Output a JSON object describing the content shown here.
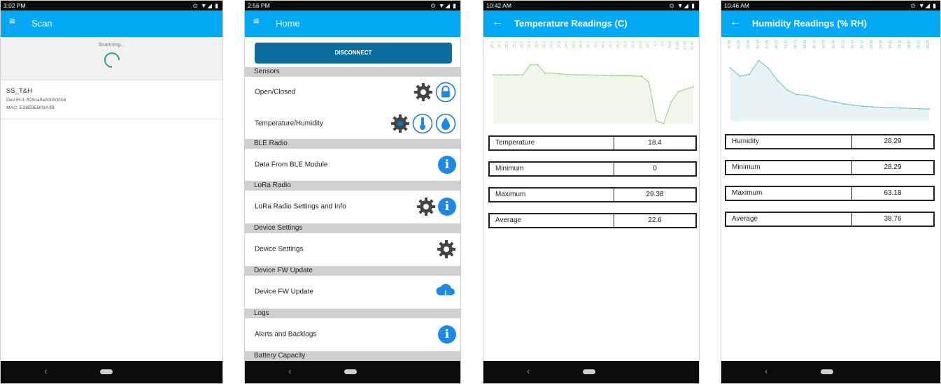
{
  "phone1": {
    "status_time": "3:02 PM",
    "title": "Scan",
    "scanning_text": "Scanning...",
    "device": {
      "name": "SS_T&H",
      "dev_eui": "Dev EUI: ff25ca0a00000004",
      "mac": "MAC: E38E9EB01A3B"
    }
  },
  "phone2": {
    "status_time": "2:56 PM",
    "title": "Home",
    "disconnect_label": "DISCONNECT",
    "sections": [
      {
        "label": "Sensors"
      },
      {
        "label": "BLE Radio"
      },
      {
        "label": "LoRa Radio"
      },
      {
        "label": "Device Settings"
      },
      {
        "label": "Device FW Update"
      },
      {
        "label": "Logs"
      },
      {
        "label": "Battery Capacity"
      }
    ],
    "rows": [
      {
        "label": "Open/Closed",
        "icons": [
          "gear-icon",
          "lock-icon"
        ]
      },
      {
        "label": "Temperature/Humidity",
        "icons": [
          "gear-icon",
          "thermometer-icon",
          "humidity-icon"
        ]
      },
      {
        "label": "Data From BLE Module",
        "icons": [
          "info-icon"
        ]
      },
      {
        "label": "LoRa Radio Settings and Info",
        "icons": [
          "gear-icon",
          "info-icon"
        ]
      },
      {
        "label": "Device Settings",
        "icons": [
          "gear-icon"
        ]
      },
      {
        "label": "Device FW Update",
        "icons": [
          "cloud-download-icon"
        ]
      },
      {
        "label": "Alerts and Backlogs",
        "icons": [
          "info-icon"
        ]
      }
    ]
  },
  "phone3": {
    "status_time": "10:42 AM",
    "title": "Temperature Readings (C)",
    "stats": [
      {
        "label": "Temperature",
        "value": "18.4"
      },
      {
        "label": "Minimum",
        "value": "0"
      },
      {
        "label": "Maximum",
        "value": "29.38"
      },
      {
        "label": "Average",
        "value": "22.6"
      }
    ],
    "chart_data": {
      "type": "area",
      "series": [
        {
          "values": [
            24.3,
            24.3,
            24.3,
            24.3,
            24.3,
            29.4,
            29.4,
            25.2,
            25.2,
            24.8,
            24.5,
            24.4,
            24.4,
            24.3,
            24.2,
            24.1,
            24.0,
            23.9,
            23.9,
            23.8,
            23.7,
            20.7,
            1.4,
            0.0,
            10.8,
            15.94,
            17.28,
            18.4
          ],
          "labels": [
            "24.3",
            "24.3",
            "25.3",
            "25.3",
            "25.1",
            "29.4",
            "29.4",
            "25.2",
            "23.5",
            "24.8",
            "24.5",
            "24.4",
            "24.4",
            "25.3",
            "25.1",
            "24.1",
            "24.0",
            "25.3",
            "25.9",
            "23.9",
            "23.8",
            "20.7",
            "1.4",
            "0.0",
            "10.8",
            "15.94",
            "17.28",
            "18.40"
          ]
        }
      ],
      "color": "#8ed37a",
      "ylim": [
        0,
        30
      ]
    }
  },
  "phone4": {
    "status_time": "10:46 AM",
    "title": "Humidity Readings (% RH)",
    "stats": [
      {
        "label": "Humidity",
        "value": "28.29"
      },
      {
        "label": "Minimum",
        "value": "28.29"
      },
      {
        "label": "Maximum",
        "value": "63.18"
      },
      {
        "label": "Average",
        "value": "38.76"
      }
    ],
    "chart_data": {
      "type": "area",
      "series": [
        {
          "values": [
            57.89,
            51.89,
            53.34,
            63.18,
            57.65,
            48.72,
            41.93,
            38.75,
            38.34,
            36.76,
            34.78,
            33.45,
            32.12,
            31.1,
            30.42,
            29.95,
            29.58,
            29.32,
            29.11,
            28.87,
            28.61,
            28.29
          ],
          "labels": [
            "57.89",
            "51.89",
            "53.34",
            "63.18",
            "57.65",
            "48.72",
            "41.93",
            "38.75",
            "38.34",
            "36.76",
            "34.78",
            "33.45",
            "32.12",
            "31.10",
            "30.42",
            "29.95",
            "29.58",
            "29.32",
            "29.11",
            "28.87",
            "28.61",
            "28.29"
          ]
        }
      ],
      "color": "#6bbdd6",
      "ylim": [
        20,
        70
      ]
    }
  },
  "nav": {
    "back_glyph": "‹"
  },
  "status_icons": "⊙ ▼◢ ▮"
}
